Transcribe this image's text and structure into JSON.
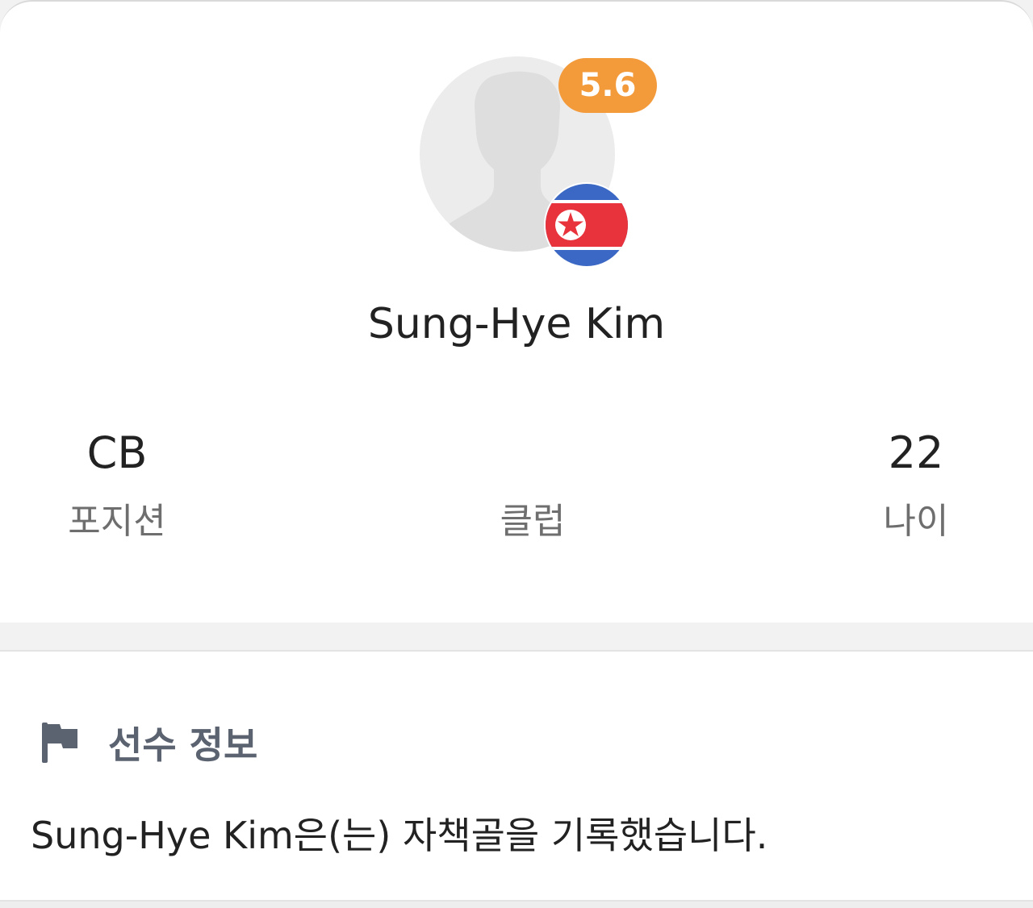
{
  "player": {
    "name": "Sung-Hye Kim",
    "rating": "5.6",
    "rating_color": "#f39a3b",
    "nationality_flag": "north-korea-flag-icon"
  },
  "stats": {
    "position": {
      "value": "CB",
      "label": "포지션"
    },
    "club": {
      "value": "",
      "label": "클럽"
    },
    "age": {
      "value": "22",
      "label": "나이"
    }
  },
  "info": {
    "icon": "flag-icon",
    "title": "선수 정보",
    "text": "Sung-Hye Kim은(는) 자책골을 기록했습니다."
  }
}
